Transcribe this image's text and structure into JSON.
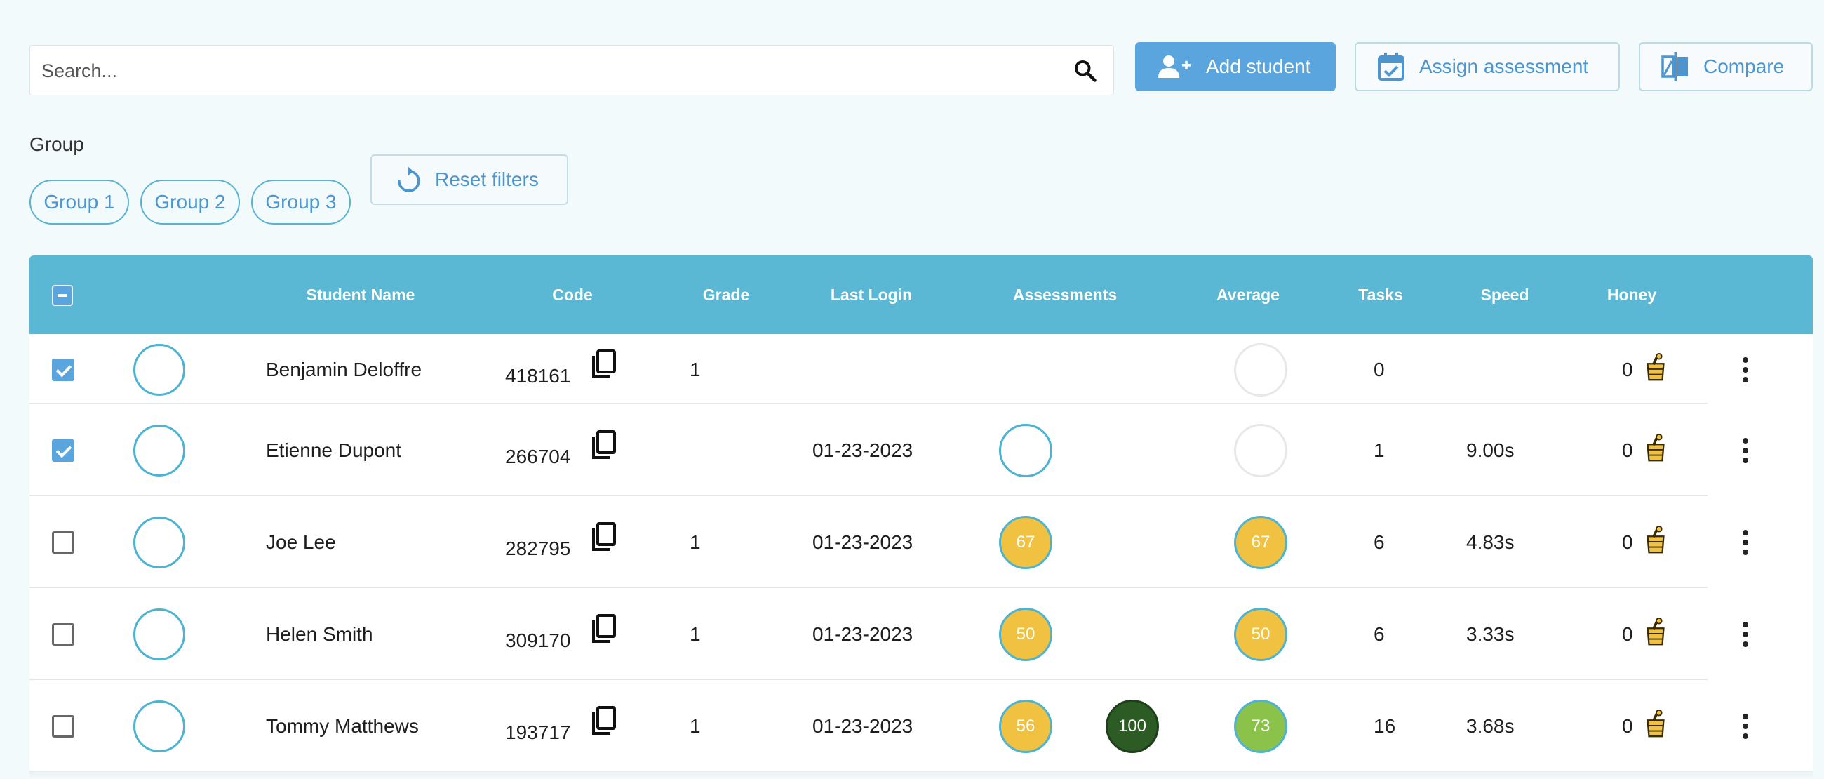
{
  "search": {
    "placeholder": "Search..."
  },
  "toolbar": {
    "add_student": "Add student",
    "assign_assessment": "Assign assessment",
    "compare": "Compare"
  },
  "filters": {
    "group_label": "Group",
    "groups": [
      "Group 1",
      "Group 2",
      "Group 3"
    ],
    "reset": "Reset filters"
  },
  "table": {
    "columns": [
      "Student Name",
      "Code",
      "Grade",
      "Last Login",
      "Assessments",
      "Average",
      "Tasks",
      "Speed",
      "Honey"
    ],
    "rows": [
      {
        "checked": true,
        "name": "Benjamin Deloffre",
        "code": "418161",
        "grade": "1",
        "last_login": "",
        "assessments": [],
        "average": "",
        "tasks": "0",
        "speed": "",
        "honey": "0"
      },
      {
        "checked": true,
        "name": "Etienne Dupont",
        "code": "266704",
        "grade": "",
        "last_login": "01-23-2023",
        "assessments": [
          ""
        ],
        "average": "",
        "tasks": "1",
        "speed": "9.00s",
        "honey": "0"
      },
      {
        "checked": false,
        "name": "Joe Lee",
        "code": "282795",
        "grade": "1",
        "last_login": "01-23-2023",
        "assessments": [
          "67"
        ],
        "average": "67",
        "tasks": "6",
        "speed": "4.83s",
        "honey": "0"
      },
      {
        "checked": false,
        "name": "Helen Smith",
        "code": "309170",
        "grade": "1",
        "last_login": "01-23-2023",
        "assessments": [
          "50"
        ],
        "average": "50",
        "tasks": "6",
        "speed": "3.33s",
        "honey": "0"
      },
      {
        "checked": false,
        "name": "Tommy Matthews",
        "code": "193717",
        "grade": "1",
        "last_login": "01-23-2023",
        "assessments": [
          "56",
          "100"
        ],
        "average": "73",
        "tasks": "16",
        "speed": "3.68s",
        "honey": "0"
      }
    ]
  },
  "colors": {
    "header": "#5ab8d5",
    "primary": "#5ba5de",
    "score_yellow": "#f1c242",
    "score_dark_green": "#2c5b24",
    "score_light_green": "#8bc34a",
    "avatar_ring": "#4cb3d3"
  },
  "icons": [
    "search-icon",
    "add-user-icon",
    "calendar-check-icon",
    "compare-icon",
    "reset-icon",
    "copy-icon",
    "honey-pot-icon",
    "more-vert-icon"
  ]
}
